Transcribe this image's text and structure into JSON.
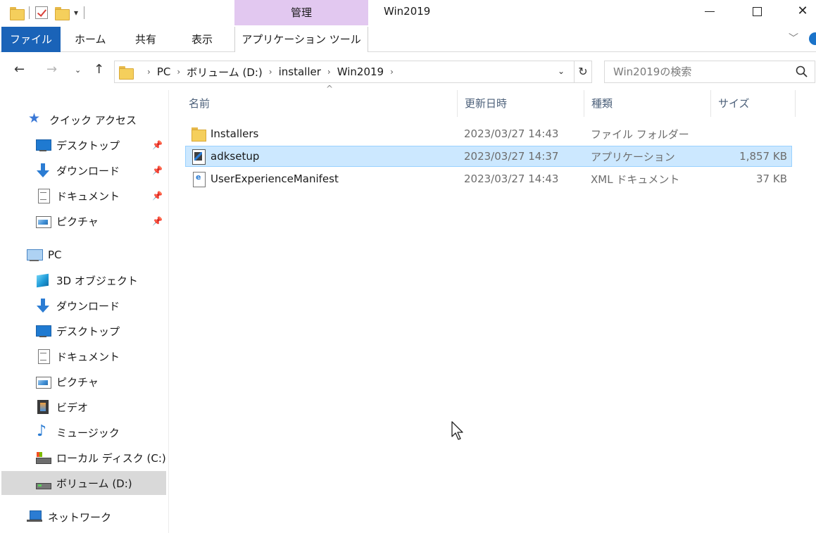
{
  "window": {
    "title": "Win2019",
    "contextual_group": "管理",
    "controls": {
      "minimize": "minimize",
      "maximize": "maximize",
      "close": "✕"
    }
  },
  "ribbon": {
    "tabs": [
      {
        "label": "ファイル",
        "active": true
      },
      {
        "label": "ホーム"
      },
      {
        "label": "共有"
      },
      {
        "label": "表示"
      },
      {
        "label": "アプリケーション ツール"
      }
    ],
    "accent": "#1a63b8",
    "contextual_color": "#e2c8f0"
  },
  "address": {
    "crumbs": [
      "PC",
      "ボリューム (D:)",
      "installer",
      "Win2019"
    ],
    "search_placeholder": "Win2019の検索"
  },
  "nav_pane": {
    "quick_access": {
      "label": "クイック アクセス",
      "items": [
        {
          "label": "デスクトップ",
          "icon": "desktop-icon",
          "pinned": true
        },
        {
          "label": "ダウンロード",
          "icon": "download-icon",
          "pinned": true
        },
        {
          "label": "ドキュメント",
          "icon": "document-icon",
          "pinned": true
        },
        {
          "label": "ピクチャ",
          "icon": "picture-icon",
          "pinned": true
        }
      ]
    },
    "pc": {
      "label": "PC",
      "items": [
        {
          "label": "3D オブジェクト",
          "icon": "3d-objects-icon"
        },
        {
          "label": "ダウンロード",
          "icon": "download-icon"
        },
        {
          "label": "デスクトップ",
          "icon": "desktop-icon"
        },
        {
          "label": "ドキュメント",
          "icon": "document-icon"
        },
        {
          "label": "ピクチャ",
          "icon": "picture-icon"
        },
        {
          "label": "ビデオ",
          "icon": "video-icon"
        },
        {
          "label": "ミュージック",
          "icon": "music-icon"
        },
        {
          "label": "ローカル ディスク (C:)",
          "icon": "local-disk-icon"
        },
        {
          "label": "ボリューム (D:)",
          "icon": "volume-icon",
          "selected": true
        }
      ]
    },
    "network": {
      "label": "ネットワーク",
      "icon": "network-icon"
    }
  },
  "file_list": {
    "columns": [
      "名前",
      "更新日時",
      "種類",
      "サイズ"
    ],
    "sort_indicator": "^",
    "rows": [
      {
        "name": "Installers",
        "modified": "2023/03/27 14:43",
        "type": "ファイル フォルダー",
        "size": "",
        "icon": "folder-icon"
      },
      {
        "name": "adksetup",
        "modified": "2023/03/27 14:37",
        "type": "アプリケーション",
        "size": "1,857 KB",
        "icon": "application-icon",
        "selected": true
      },
      {
        "name": "UserExperienceManifest",
        "modified": "2023/03/27 14:43",
        "type": "XML ドキュメント",
        "size": "37 KB",
        "icon": "xml-document-icon"
      }
    ],
    "selection_color": "#cce8ff"
  }
}
